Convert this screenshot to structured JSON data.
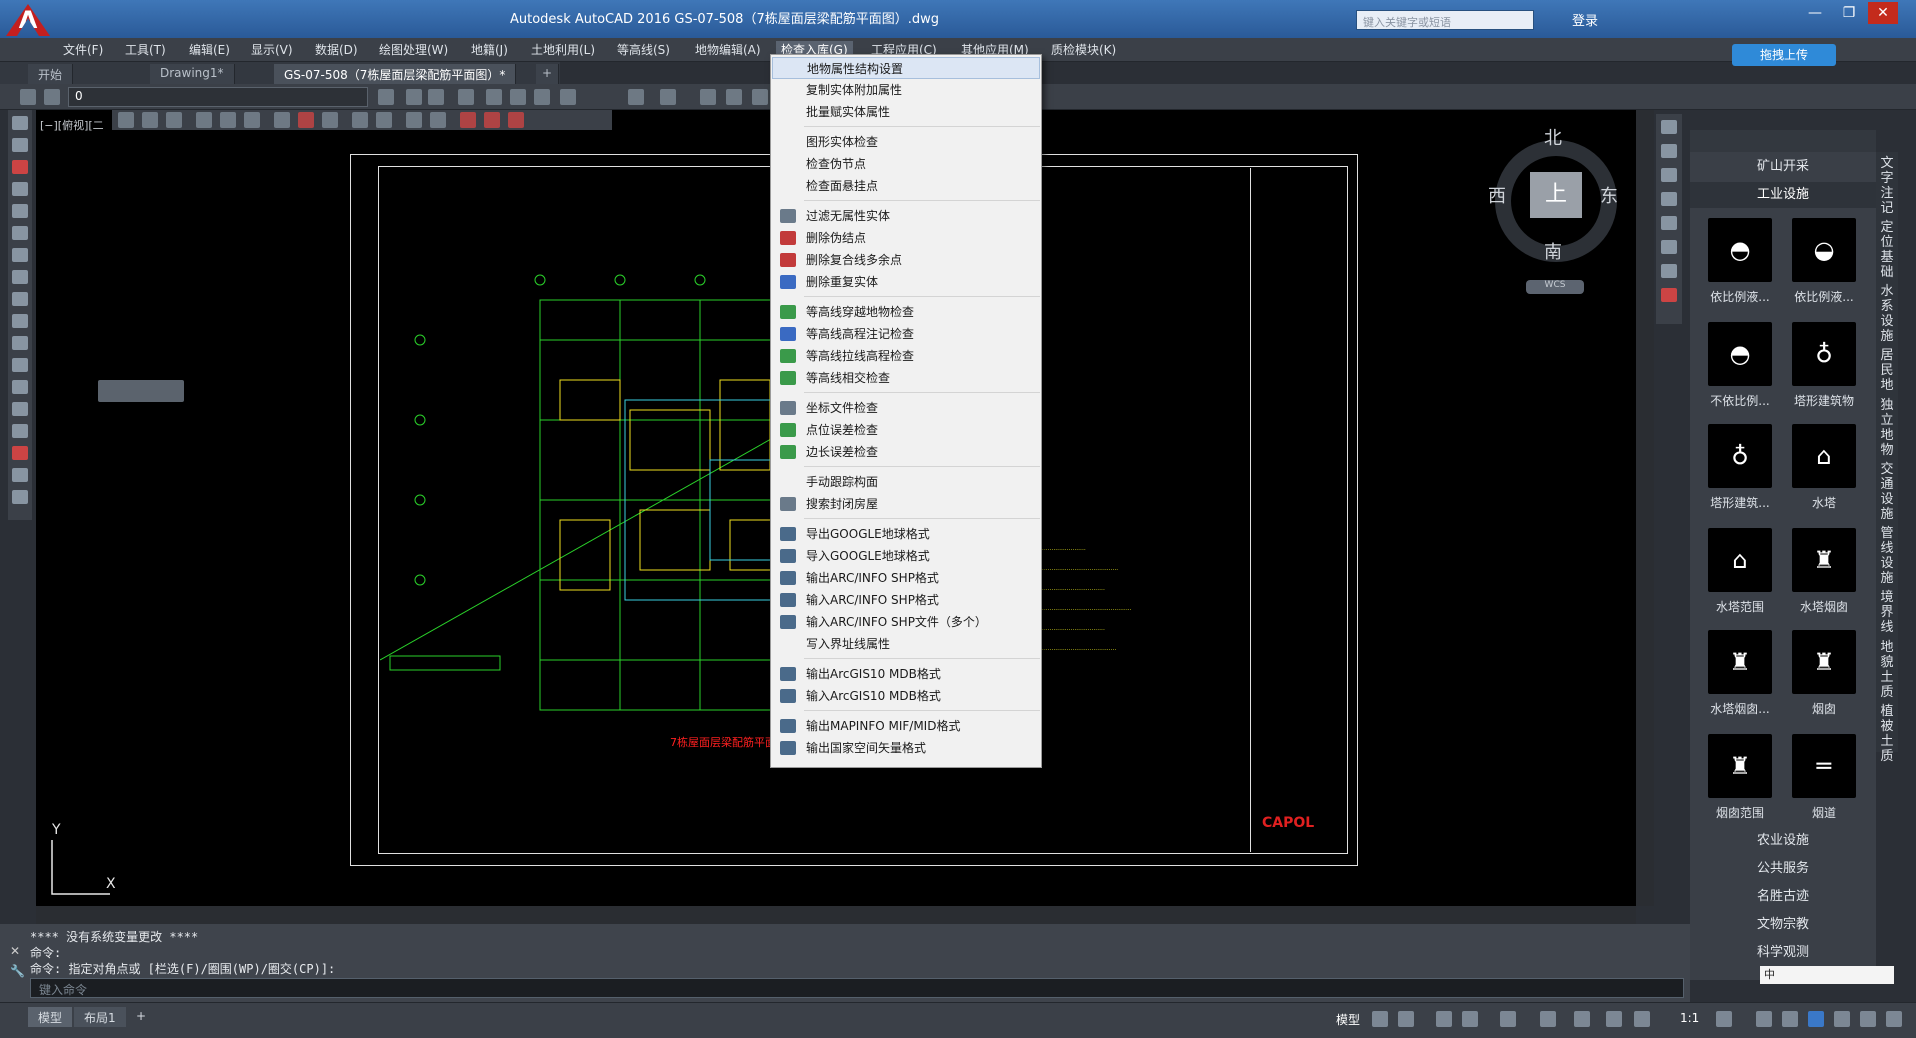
{
  "window": {
    "title": "Autodesk AutoCAD 2016    GS-07-508（7栋屋面层梁配筋平面图）.dwg",
    "search_placeholder": "键入关键字或短语",
    "login": "登录"
  },
  "menus": [
    "文件(F)",
    "工具(T)",
    "编辑(E)",
    "显示(V)",
    "数据(D)",
    "绘图处理(W)",
    "地籍(J)",
    "土地利用(L)",
    "等高线(S)",
    "地物编辑(A)",
    "检查入库(G)",
    "工程应用(C)",
    "其他应用(M)",
    "质检模块(K)"
  ],
  "doc_tabs": [
    "开始",
    "Drawing1*",
    "GS-07-508（7栋屋面层梁配筋平面图）*"
  ],
  "cloud_upload": "拖拽上传",
  "layer_value": "0",
  "viewport_label": "[−][俯视][二",
  "dropdown_items": [
    {
      "label": "地物属性结构设置",
      "icon": "none-icon"
    },
    {
      "label": "复制实体附加属性",
      "icon": "none-icon"
    },
    {
      "label": "批量赋实体属性",
      "icon": "none-icon"
    },
    {
      "label": "图形实体检查",
      "icon": "none-icon"
    },
    {
      "label": "检查伪节点",
      "icon": "none-icon"
    },
    {
      "label": "检查面悬挂点",
      "icon": "none-icon"
    },
    {
      "label": "过滤无属性实体",
      "icon": "filter-icon"
    },
    {
      "label": "删除伪结点",
      "icon": "delete-node-icon"
    },
    {
      "label": "删除复合线多余点",
      "icon": "delete-polyline-point-icon"
    },
    {
      "label": "删除重复实体",
      "icon": "delete-duplicate-icon"
    },
    {
      "label": "等高线穿越地物检查",
      "icon": "contour-cross-icon"
    },
    {
      "label": "等高线高程注记检查",
      "icon": "contour-label-icon"
    },
    {
      "label": "等高线拉线高程检查",
      "icon": "contour-line-icon"
    },
    {
      "label": "等高线相交检查",
      "icon": "contour-intersect-icon"
    },
    {
      "label": "坐标文件检查",
      "icon": "coord-file-icon"
    },
    {
      "label": "点位误差检查",
      "icon": "point-error-icon"
    },
    {
      "label": "边长误差检查",
      "icon": "edge-error-icon"
    },
    {
      "label": "手动跟踪构面",
      "icon": "none-icon"
    },
    {
      "label": "搜索封闭房屋",
      "icon": "house-search-icon"
    },
    {
      "label": "导出GOOGLE地球格式",
      "icon": "export-icon"
    },
    {
      "label": "导入GOOGLE地球格式",
      "icon": "import-icon"
    },
    {
      "label": "输出ARC/INFO SHP格式",
      "icon": "export-icon"
    },
    {
      "label": "输入ARC/INFO SHP格式",
      "icon": "import-icon"
    },
    {
      "label": "输入ARC/INFO SHP文件（多个）",
      "icon": "import-icon"
    },
    {
      "label": "写入界址线属性",
      "icon": "none-icon"
    },
    {
      "label": "输出ArcGIS10 MDB格式",
      "icon": "export-icon"
    },
    {
      "label": "输入ArcGIS10 MDB格式",
      "icon": "import-icon"
    },
    {
      "label": "输出MAPINFO MIF/MID格式",
      "icon": "export-icon"
    },
    {
      "label": "输出国家空间矢量格式",
      "icon": "export-icon"
    }
  ],
  "compass": {
    "north": "北",
    "south": "南",
    "east": "东",
    "west": "西",
    "top": "上",
    "wcs": "WCS"
  },
  "ucs": {
    "x": "X",
    "y": "Y"
  },
  "palette": {
    "categories_top": [
      "矿山开采",
      "工业设施"
    ],
    "tiles": [
      "依比例液...",
      "依比例液...",
      "不依比例...",
      "塔形建筑物",
      "塔形建筑...",
      "水塔",
      "水塔范围",
      "水塔烟囱",
      "水塔烟囱...",
      "烟囱",
      "烟囱范围",
      "烟道"
    ],
    "tile_glyphs": [
      "◓",
      "◒",
      "◓",
      "♁",
      "♁",
      "⌂",
      "⌂",
      "♜",
      "♜",
      "♜",
      "♜",
      "═"
    ],
    "categories_bottom": [
      "农业设施",
      "公共服务",
      "名胜古迹",
      "文物宗教",
      "科学观测"
    ],
    "side_tabs": [
      "文字注记",
      "定位基础",
      "水系设施",
      "居民地",
      "独立地物",
      "交通设施",
      "管线设施",
      "境界线",
      "地貌土质",
      "植被土质"
    ]
  },
  "command": {
    "line1": "**** 没有系统变量更改 ****",
    "line2": "命令:",
    "line3": "命令: 指定对角点或 [栏选(F)/圈围(WP)/圈交(CP)]:",
    "input_placeholder": "键入命令"
  },
  "status": {
    "model_tab": "模型",
    "layout_tab": "布局1",
    "add": "+",
    "model_label": "模型",
    "scale": "1:1"
  },
  "drawing": {
    "company": "CAPOL",
    "red_title": "7栋屋面层梁配筋平面图"
  },
  "ime": "中"
}
